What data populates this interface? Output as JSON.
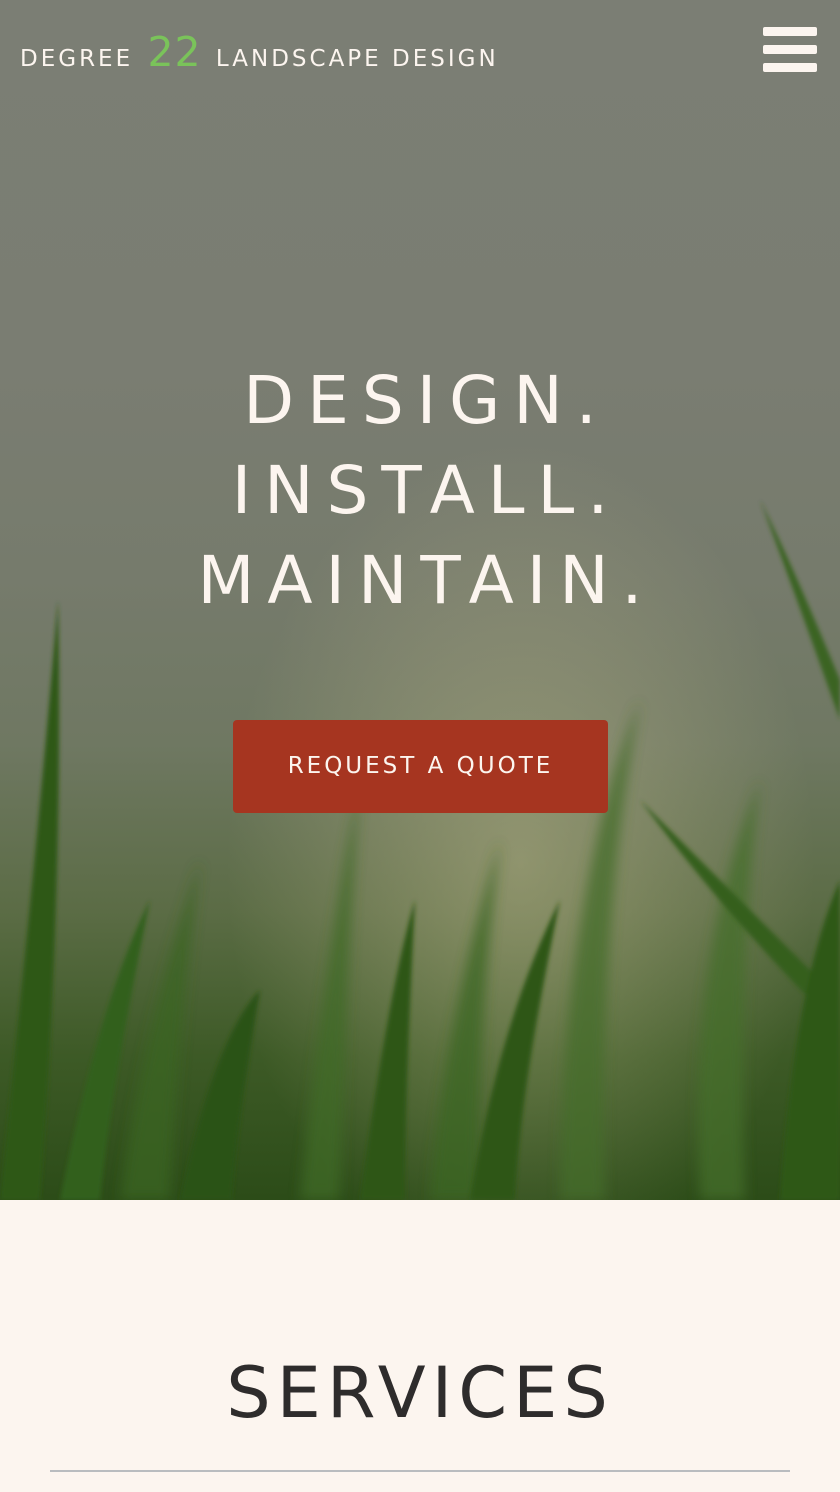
{
  "header": {
    "brand_prefix": "DEGREE",
    "brand_number": "22",
    "brand_suffix": "LANDSCAPE DESIGN",
    "menu_icon": "hamburger-menu-icon"
  },
  "hero": {
    "headline_lines": [
      "DESIGN.",
      "INSTALL.",
      "MAINTAIN."
    ],
    "cta_label": "REQUEST A QUOTE",
    "background_image": "grass blades close-up"
  },
  "services": {
    "title": "SERVICES"
  },
  "colors": {
    "accent_green": "#7ac35a",
    "cta_red": "#a63520",
    "cream": "#fcf5ef",
    "heading_dark": "#2e2c2c",
    "divider_gray": "#b9bcbf"
  }
}
